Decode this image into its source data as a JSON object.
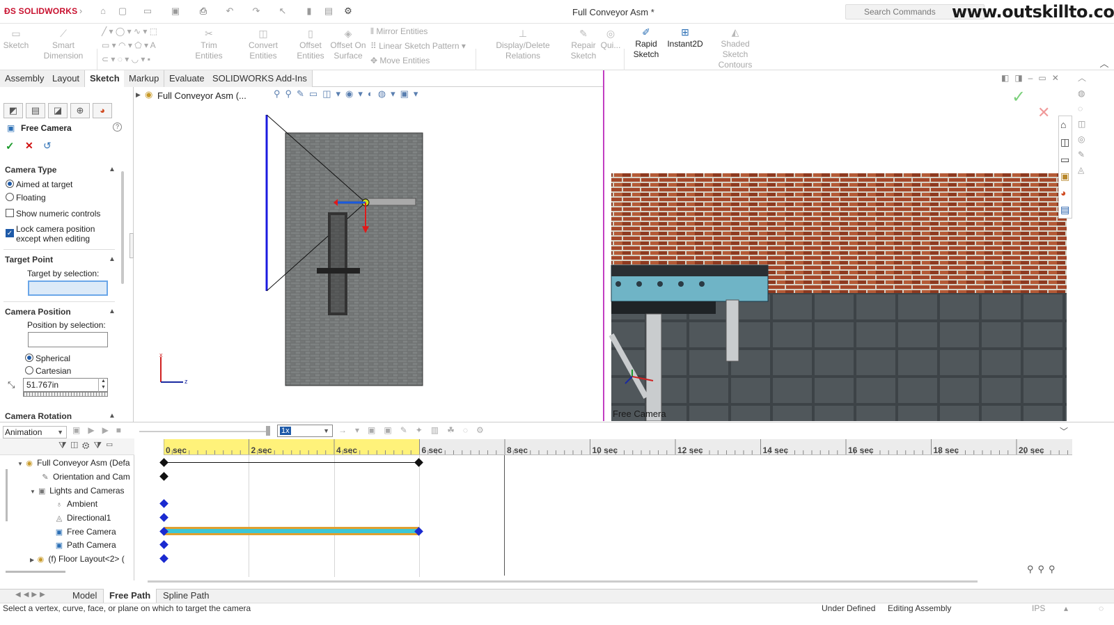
{
  "titlebar": {
    "app_logo": "SOLIDWORKS",
    "document_title": "Full Conveyor Asm *",
    "search_placeholder": "Search Commands",
    "watermark": "www.outskillto.com"
  },
  "ribbon": {
    "sketch": "Sketch",
    "smart_dimension": "Smart Dimension",
    "trim_entities": "Trim Entities",
    "convert_entities": "Convert Entities",
    "offset_entities": "Offset Entities",
    "offset_on_surface": "Offset On Surface",
    "mirror_entities": "Mirror Entities",
    "linear_sketch_pattern": "Linear Sketch Pattern",
    "move_entities": "Move Entities",
    "display_delete_relations": "Display/Delete Relations",
    "repair_sketch": "Repair Sketch",
    "quick_snaps": "Qui...",
    "rapid_sketch": "Rapid Sketch",
    "instant2d": "Instant2D",
    "shaded_sketch_contours": "Shaded Sketch Contours"
  },
  "tabs": [
    "Assembly",
    "Layout",
    "Sketch",
    "Markup",
    "Evaluate",
    "SOLIDWORKS Add-Ins"
  ],
  "active_tab": "Sketch",
  "property_manager": {
    "title": "Free Camera",
    "camera_type": {
      "header": "Camera Type",
      "aimed_at_target": "Aimed at target",
      "floating": "Floating",
      "show_numeric_controls": "Show numeric controls",
      "lock_camera_line1": "Lock camera position",
      "lock_camera_line2": "except when editing"
    },
    "target_point": {
      "header": "Target Point",
      "target_by_selection": "Target by selection:"
    },
    "camera_position": {
      "header": "Camera Position",
      "position_by_selection": "Position by selection:",
      "spherical": "Spherical",
      "cartesian": "Cartesian",
      "distance_value": "51.767in"
    },
    "camera_rotation": {
      "header": "Camera Rotation"
    }
  },
  "viewport1": {
    "breadcrumb": "Full Conveyor Asm (..."
  },
  "viewport2": {
    "label": "Free Camera"
  },
  "animation": {
    "study_type": "Animation",
    "playback_speed": "1x",
    "time_ticks": [
      "0 sec",
      "2 sec",
      "4 sec",
      "6 sec",
      "8 sec",
      "10 sec",
      "12 sec",
      "14 sec",
      "16 sec",
      "18 sec",
      "20 sec"
    ],
    "tree": [
      "Full Conveyor Asm (Defa",
      "Orientation and Cam",
      "Lights and Cameras",
      "Ambient",
      "Directional1",
      "Free Camera",
      "Path Camera",
      "(f) Floor Layout<2> ("
    ]
  },
  "bottom_tabs": [
    "Model",
    "Free Path",
    "Spline Path"
  ],
  "active_bottom_tab": "Free Path",
  "status": {
    "message": "Select a vertex, curve, face, or plane on which to target the camera",
    "under_defined": "Under Defined",
    "editing_assembly": "Editing Assembly",
    "units": "IPS"
  },
  "colors": {
    "accent": "#1e5aa8",
    "timeline_highlight": "#fff27a",
    "camera_track": "#3cc7d6",
    "camera_track_border": "#e0a030",
    "viewport_border": "#c13dc1"
  }
}
